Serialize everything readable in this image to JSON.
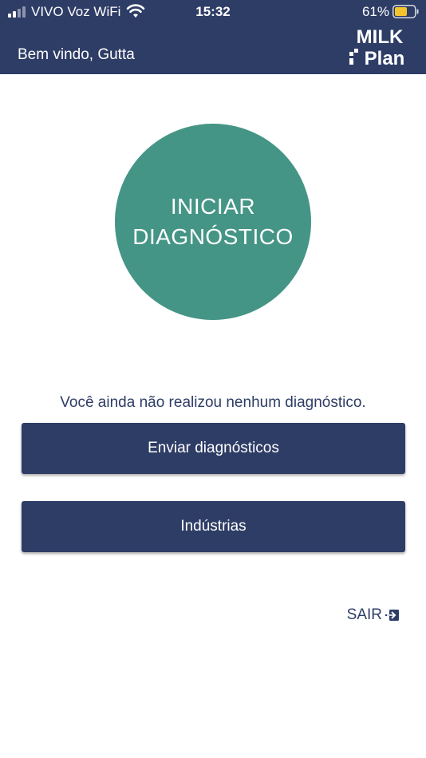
{
  "status_bar": {
    "carrier": "VIVO Voz WiFi",
    "time": "15:32",
    "battery_percent": "61%",
    "icons": [
      "cellular-signal-icon",
      "wifi-icon",
      "battery-icon"
    ]
  },
  "header": {
    "welcome": "Bem vindo, Gutta",
    "logo_text": [
      "Milk",
      "Plan"
    ],
    "background": "#2e3d66"
  },
  "main": {
    "start_button": {
      "line1": "INICIAR",
      "line2": "DIAGNÓSTICO",
      "color": "#449585"
    },
    "empty_message": "Você ainda não realizou nenhum diagnóstico.",
    "send_button": "Enviar diagnósticos",
    "industries_button": "Indústrias",
    "logout_label": "SAIR",
    "logout_icon": "sign-out-icon"
  }
}
